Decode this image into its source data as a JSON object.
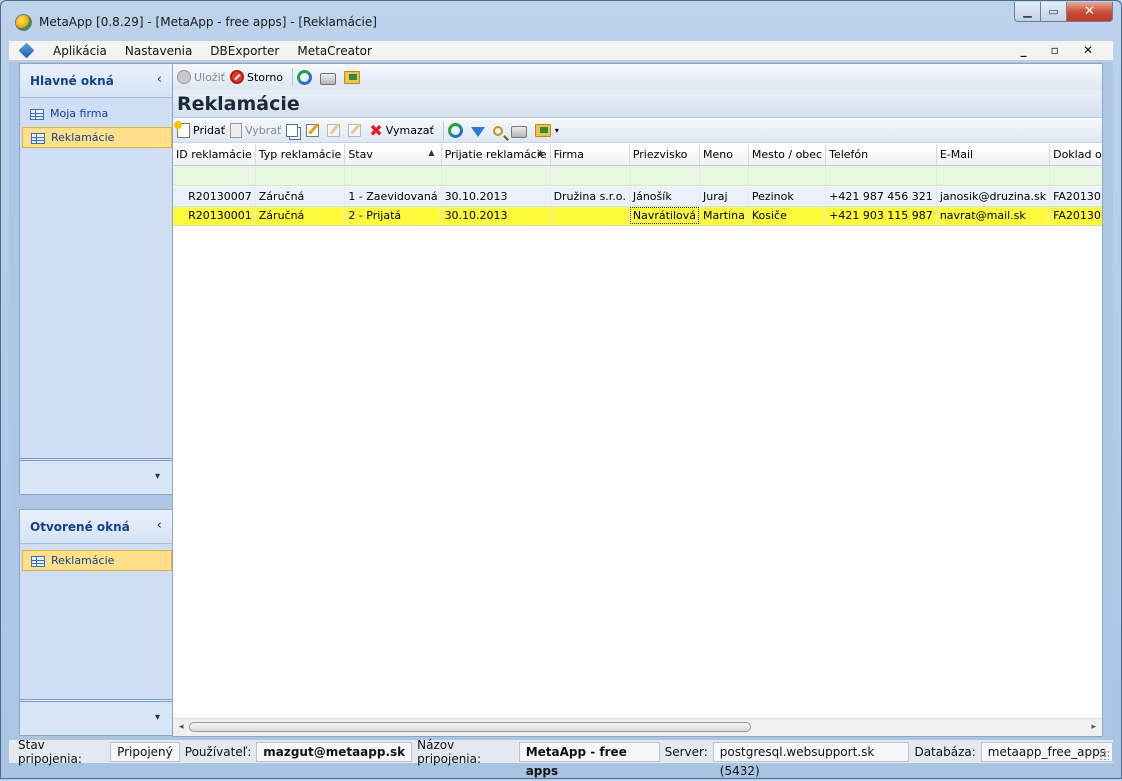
{
  "window": {
    "title": "MetaApp  [0.8.29] - [MetaApp - free apps] - [Reklamácie]",
    "min_glyph": "▁",
    "max_glyph": "▭",
    "close_glyph": "✕"
  },
  "menu": {
    "items": [
      "Aplikácia",
      "Nastavenia",
      "DBExporter",
      "MetaCreator"
    ],
    "mdi_controls": "_ ▫ ✕"
  },
  "sidebar": {
    "main_windows": {
      "title": "Hlavné okná",
      "chevron": "‹",
      "items": [
        {
          "label": "Moja firma",
          "selected": false
        },
        {
          "label": "Reklamácie",
          "selected": true
        }
      ],
      "footer_chevron": "▾"
    },
    "open_windows": {
      "title": "Otvorené okná",
      "chevron": "‹",
      "items": [
        {
          "label": "Reklamácie",
          "selected": true
        }
      ],
      "footer_chevron": "▾"
    }
  },
  "toolbar1": {
    "save_label": "Uložiť",
    "cancel_label": "Storno"
  },
  "page_title": "Reklamácie",
  "toolbar2": {
    "add_label": "Pridať",
    "select_label": "Vybrať",
    "delete_label": "Vymazať",
    "delete_glyph": "✖",
    "dropdown_glyph": "▾"
  },
  "grid": {
    "columns": [
      "ID reklamácie",
      "Typ reklamácie",
      "Stav",
      "Prijatie reklamácie",
      "Firma",
      "Priezvisko",
      "Meno",
      "Mesto / obec",
      "Telefón",
      "E-Mail",
      "Doklad o"
    ],
    "sort_glyph": "▲",
    "rows": [
      [
        "R20130007",
        "Záručná",
        "1 - Zaevidovaná",
        "30.10.2013",
        "Družina s.r.o.",
        "Jánošík",
        "Juraj",
        "Pezinok",
        "+421 987 456 321",
        "janosik@druzina.sk",
        "FA20130"
      ],
      [
        "R20130001",
        "Záručná",
        "2 - Prijatá",
        "30.10.2013",
        "",
        "Navrátilová",
        "Martina",
        "Kosiče",
        "+421 903 115 987",
        "navrat@mail.sk",
        "FA20130"
      ]
    ]
  },
  "scrollbar": {
    "left_glyph": "◂",
    "right_glyph": "▸"
  },
  "statusbar": {
    "connection_state_label": "Stav pripojenia:",
    "connection_state_value": "Pripojený",
    "user_label": "Používateľ:",
    "user_value": "mazgut@metaapp.sk",
    "connection_name_label": "Názov pripojenia:",
    "connection_name_value": "MetaApp - free apps",
    "server_label": "Server:",
    "server_value": "postgresql.websupport.sk (5432)",
    "database_label": "Databáza:",
    "database_value": "metaapp_free_apps"
  }
}
